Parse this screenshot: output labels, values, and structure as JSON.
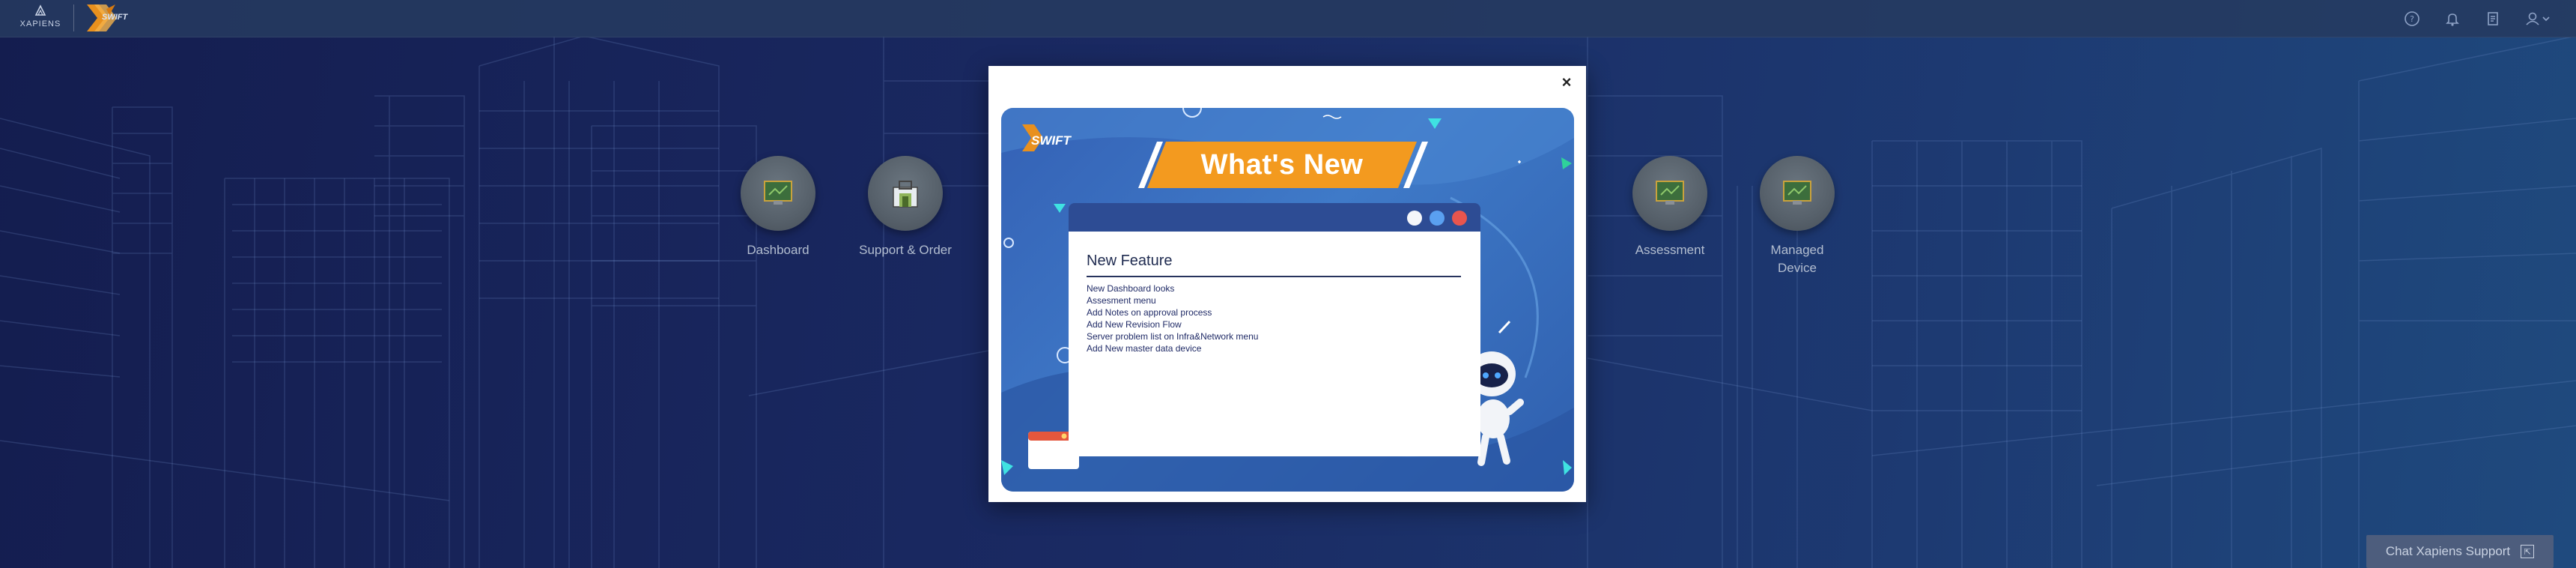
{
  "header": {
    "brand_name": "XAPIENS",
    "product_name": "SWIFT",
    "icons": [
      "help-circle-icon",
      "bell-icon",
      "notes-icon",
      "user-icon"
    ]
  },
  "modules": [
    {
      "label": "Dashboard",
      "icon": "monitor-icon"
    },
    {
      "label": "Support & Order",
      "icon": "toolbox-icon"
    },
    {
      "label": "Assessment",
      "icon": "monitor-icon"
    },
    {
      "label": "Managed Device",
      "icon": "monitor-icon"
    }
  ],
  "modal": {
    "close_label": "×",
    "banner_logo": "SWIFT",
    "banner_title": "What's New",
    "feature_title": "New Feature",
    "features": [
      "New Dashboard looks",
      "Assesment menu",
      "Add Notes on approval process",
      "Add New Revision Flow",
      "Server problem list on Infra&Network menu",
      "Add New master data device"
    ]
  },
  "chat": {
    "label": "Chat Xapiens Support"
  },
  "colors": {
    "background": "#1a2a63",
    "topbar": "#263a60",
    "ribbon_orange": "#f39a1f",
    "banner_blue": "#3f7ac8",
    "chat_button": "#4d5d7d"
  }
}
